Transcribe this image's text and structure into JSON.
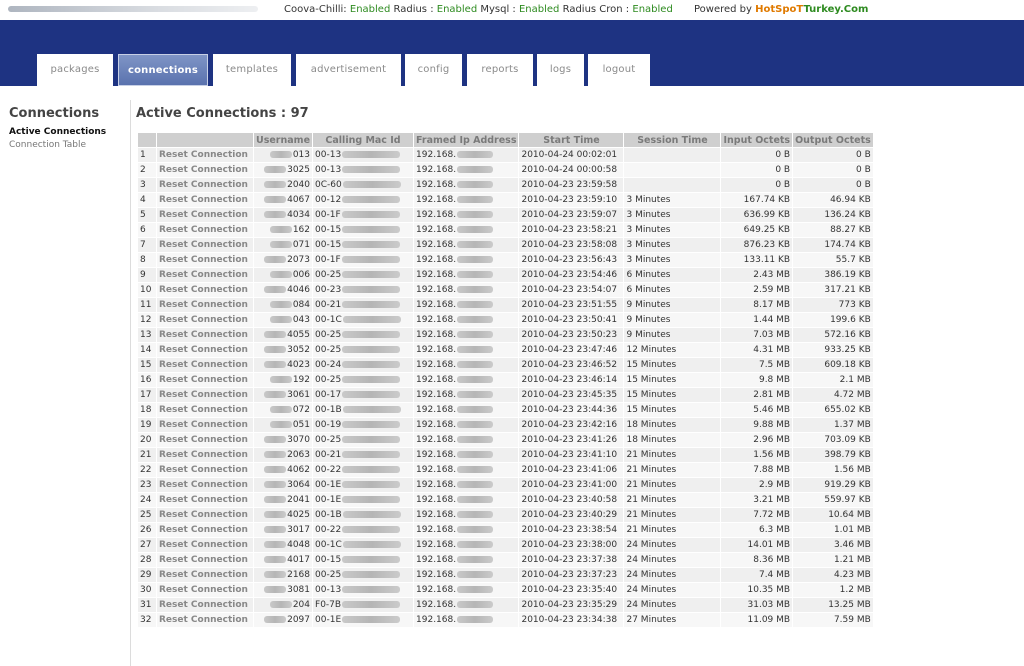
{
  "status_bar": {
    "segments": [
      "Coova-Chilli:",
      "Enabled",
      "Radius :",
      "Enabled",
      "Mysql :",
      "Enabled",
      "Radius Cron :",
      "Enabled"
    ],
    "powered_by": "Powered by",
    "brand_part1": "HotSpoT",
    "brand_part2": "Turkey.Com"
  },
  "nav": {
    "tabs": [
      "packages",
      "connections",
      "templates",
      "advertisement",
      "config",
      "reports",
      "logs",
      "logout"
    ],
    "active": "connections"
  },
  "sidebar": {
    "title": "Connections",
    "items": [
      "Active Connections",
      "Connection Table"
    ],
    "active_index": 0
  },
  "main": {
    "title": "Active Connections : 97",
    "columns": [
      "",
      "",
      "Username",
      "Calling Mac Id",
      "Framed Ip Address",
      "Start Time",
      "Session Time",
      "Input Octets",
      "Output Octets"
    ],
    "reset_label": "Reset Connection",
    "rows": [
      {
        "n": "1",
        "user": "013",
        "mac": "00-13",
        "ip": "192.168.",
        "start": "2010-04-24 00:02:01",
        "sess": "",
        "in": "0 B",
        "out": "0 B"
      },
      {
        "n": "2",
        "user": "3025",
        "mac": "00-13",
        "ip": "192.168.",
        "start": "2010-04-24 00:00:58",
        "sess": "",
        "in": "0 B",
        "out": "0 B"
      },
      {
        "n": "3",
        "user": "2040",
        "mac": "0C-60",
        "ip": "192.168.",
        "start": "2010-04-23 23:59:58",
        "sess": "",
        "in": "0 B",
        "out": "0 B"
      },
      {
        "n": "4",
        "user": "4067",
        "mac": "00-12",
        "ip": "192.168.",
        "start": "2010-04-23 23:59:10",
        "sess": "3 Minutes",
        "in": "167.74 KB",
        "out": "46.94 KB"
      },
      {
        "n": "5",
        "user": "4034",
        "mac": "00-1F",
        "ip": "192.168.",
        "start": "2010-04-23 23:59:07",
        "sess": "3 Minutes",
        "in": "636.99 KB",
        "out": "136.24 KB"
      },
      {
        "n": "6",
        "user": "162",
        "mac": "00-15",
        "ip": "192.168.",
        "start": "2010-04-23 23:58:21",
        "sess": "3 Minutes",
        "in": "649.25 KB",
        "out": "88.27 KB"
      },
      {
        "n": "7",
        "user": "071",
        "mac": "00-15",
        "ip": "192.168.",
        "start": "2010-04-23 23:58:08",
        "sess": "3 Minutes",
        "in": "876.23 KB",
        "out": "174.74 KB"
      },
      {
        "n": "8",
        "user": "2073",
        "mac": "00-1F",
        "ip": "192.168.",
        "start": "2010-04-23 23:56:43",
        "sess": "3 Minutes",
        "in": "133.11 KB",
        "out": "55.7 KB"
      },
      {
        "n": "9",
        "user": "006",
        "mac": "00-25",
        "ip": "192.168.",
        "start": "2010-04-23 23:54:46",
        "sess": "6 Minutes",
        "in": "2.43 MB",
        "out": "386.19 KB"
      },
      {
        "n": "10",
        "user": "4046",
        "mac": "00-23",
        "ip": "192.168.",
        "start": "2010-04-23 23:54:07",
        "sess": "6 Minutes",
        "in": "2.59 MB",
        "out": "317.21 KB"
      },
      {
        "n": "11",
        "user": "084",
        "mac": "00-21",
        "ip": "192.168.",
        "start": "2010-04-23 23:51:55",
        "sess": "9 Minutes",
        "in": "8.17 MB",
        "out": "773 KB"
      },
      {
        "n": "12",
        "user": "043",
        "mac": "00-1C",
        "ip": "192.168.",
        "start": "2010-04-23 23:50:41",
        "sess": "9 Minutes",
        "in": "1.44 MB",
        "out": "199.6 KB"
      },
      {
        "n": "13",
        "user": "4055",
        "mac": "00-25",
        "ip": "192.168.",
        "start": "2010-04-23 23:50:23",
        "sess": "9 Minutes",
        "in": "7.03 MB",
        "out": "572.16 KB"
      },
      {
        "n": "14",
        "user": "3052",
        "mac": "00-25",
        "ip": "192.168.",
        "start": "2010-04-23 23:47:46",
        "sess": "12 Minutes",
        "in": "4.31 MB",
        "out": "933.25 KB"
      },
      {
        "n": "15",
        "user": "4023",
        "mac": "00-24",
        "ip": "192.168.",
        "start": "2010-04-23 23:46:52",
        "sess": "15 Minutes",
        "in": "7.5 MB",
        "out": "609.18 KB"
      },
      {
        "n": "16",
        "user": "192",
        "mac": "00-25",
        "ip": "192.168.",
        "start": "2010-04-23 23:46:14",
        "sess": "15 Minutes",
        "in": "9.8 MB",
        "out": "2.1 MB"
      },
      {
        "n": "17",
        "user": "3061",
        "mac": "00-17",
        "ip": "192.168.",
        "start": "2010-04-23 23:45:35",
        "sess": "15 Minutes",
        "in": "2.81 MB",
        "out": "4.72 MB"
      },
      {
        "n": "18",
        "user": "072",
        "mac": "00-1B",
        "ip": "192.168.",
        "start": "2010-04-23 23:44:36",
        "sess": "15 Minutes",
        "in": "5.46 MB",
        "out": "655.02 KB"
      },
      {
        "n": "19",
        "user": "051",
        "mac": "00-19",
        "ip": "192.168.",
        "start": "2010-04-23 23:42:16",
        "sess": "18 Minutes",
        "in": "9.88 MB",
        "out": "1.37 MB"
      },
      {
        "n": "20",
        "user": "3070",
        "mac": "00-25",
        "ip": "192.168.",
        "start": "2010-04-23 23:41:26",
        "sess": "18 Minutes",
        "in": "2.96 MB",
        "out": "703.09 KB"
      },
      {
        "n": "21",
        "user": "2063",
        "mac": "00-21",
        "ip": "192.168.",
        "start": "2010-04-23 23:41:10",
        "sess": "21 Minutes",
        "in": "1.56 MB",
        "out": "398.79 KB"
      },
      {
        "n": "22",
        "user": "4062",
        "mac": "00-22",
        "ip": "192.168.",
        "start": "2010-04-23 23:41:06",
        "sess": "21 Minutes",
        "in": "7.88 MB",
        "out": "1.56 MB"
      },
      {
        "n": "23",
        "user": "3064",
        "mac": "00-1E",
        "ip": "192.168.",
        "start": "2010-04-23 23:41:00",
        "sess": "21 Minutes",
        "in": "2.9 MB",
        "out": "919.29 KB"
      },
      {
        "n": "24",
        "user": "2041",
        "mac": "00-1E",
        "ip": "192.168.",
        "start": "2010-04-23 23:40:58",
        "sess": "21 Minutes",
        "in": "3.21 MB",
        "out": "559.97 KB"
      },
      {
        "n": "25",
        "user": "4025",
        "mac": "00-1B",
        "ip": "192.168.",
        "start": "2010-04-23 23:40:29",
        "sess": "21 Minutes",
        "in": "7.72 MB",
        "out": "10.64 MB"
      },
      {
        "n": "26",
        "user": "3017",
        "mac": "00-22",
        "ip": "192.168.",
        "start": "2010-04-23 23:38:54",
        "sess": "21 Minutes",
        "in": "6.3 MB",
        "out": "1.01 MB"
      },
      {
        "n": "27",
        "user": "4048",
        "mac": "00-1C",
        "ip": "192.168.",
        "start": "2010-04-23 23:38:00",
        "sess": "24 Minutes",
        "in": "14.01 MB",
        "out": "3.46 MB"
      },
      {
        "n": "28",
        "user": "4017",
        "mac": "00-15",
        "ip": "192.168.",
        "start": "2010-04-23 23:37:38",
        "sess": "24 Minutes",
        "in": "8.36 MB",
        "out": "1.21 MB"
      },
      {
        "n": "29",
        "user": "2168",
        "mac": "00-25",
        "ip": "192.168.",
        "start": "2010-04-23 23:37:23",
        "sess": "24 Minutes",
        "in": "7.4 MB",
        "out": "4.23 MB"
      },
      {
        "n": "30",
        "user": "3081",
        "mac": "00-13",
        "ip": "192.168.",
        "start": "2010-04-23 23:35:40",
        "sess": "24 Minutes",
        "in": "10.35 MB",
        "out": "1.2 MB"
      },
      {
        "n": "31",
        "user": "204",
        "mac": "F0-7B",
        "ip": "192.168.",
        "start": "2010-04-23 23:35:29",
        "sess": "24 Minutes",
        "in": "31.03 MB",
        "out": "13.25 MB"
      },
      {
        "n": "32",
        "user": "2097",
        "mac": "00-1E",
        "ip": "192.168.",
        "start": "2010-04-23 23:34:38",
        "sess": "27 Minutes",
        "in": "11.09 MB",
        "out": "7.59 MB"
      }
    ]
  }
}
